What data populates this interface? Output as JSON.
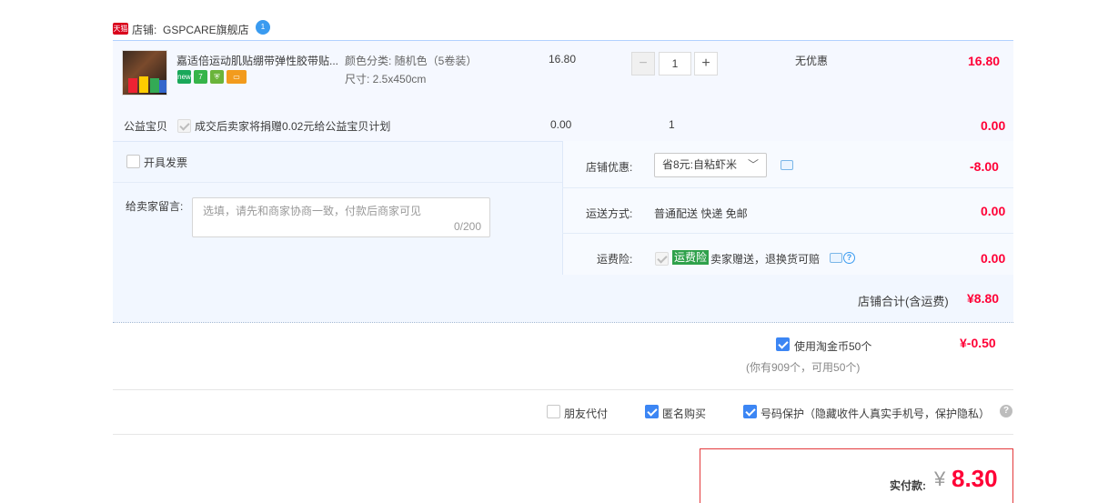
{
  "shop": {
    "badge": "天猫",
    "label": "店铺:",
    "name": "GSPCARE旗舰店",
    "ww_badge": "1"
  },
  "item": {
    "title": "嘉适倍运动肌贴绷带弹性胶带贴...",
    "sku_color": "颜色分类: 随机色（5卷装）",
    "sku_size": "尺寸: 2.5x450cm",
    "price": "16.80",
    "qty": "1",
    "qty_minus": "−",
    "qty_plus": "+",
    "discount": "无优惠",
    "subtotal": "16.80",
    "service_icons": [
      "new",
      "7",
      "guarantee",
      "card"
    ]
  },
  "charity": {
    "label": "公益宝贝",
    "text": "成交后卖家将捐赠0.02元给公益宝贝计划",
    "price": "0.00",
    "qty": "1",
    "subtotal": "0.00"
  },
  "invoice": {
    "label": "开具发票"
  },
  "message": {
    "label": "给卖家留言:",
    "placeholder": "选填，请先和商家协商一致，付款后商家可见",
    "counter": "0/200"
  },
  "shop_coupon": {
    "label": "店铺优惠:",
    "selected": "省8元:自粘虾米",
    "amount": "-8.00"
  },
  "shipping": {
    "label": "运送方式:",
    "value": "普通配送 快递 免邮",
    "amount": "0.00"
  },
  "insurance": {
    "label": "运费险:",
    "tag": "运费险",
    "text": "卖家赠送，退换货可赔",
    "amount": "0.00"
  },
  "shop_total": {
    "label": "店铺合计(含运费)",
    "amount": "¥8.80"
  },
  "coins": {
    "label": "使用淘金币50个",
    "sub": "(你有909个，可用50个)",
    "amount": "¥-0.50"
  },
  "options": {
    "friend_pay": "朋友代付",
    "anonymous": "匿名购买",
    "privacy": "号码保护（隐藏收件人真实手机号，保护隐私）"
  },
  "pay": {
    "label": "实付款:",
    "currency": "¥",
    "amount": "8.30"
  },
  "colors": {
    "accent_red": "#ff0036",
    "check_blue": "#3c86f4",
    "panel_blue": "#f2f7ff",
    "insure_green": "#2fa14b"
  }
}
